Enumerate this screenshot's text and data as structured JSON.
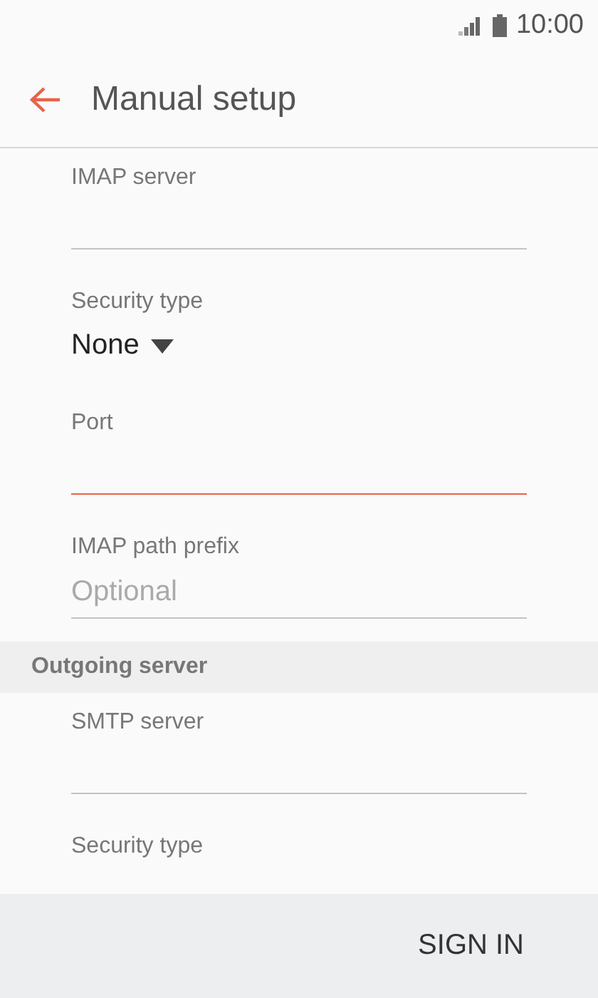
{
  "status_bar": {
    "time": "10:00"
  },
  "app_bar": {
    "title": "Manual setup"
  },
  "content": [
    {
      "kind": "text",
      "label": "IMAP server",
      "focused": false
    },
    {
      "kind": "dropdown",
      "label": "Security type",
      "value": "None"
    },
    {
      "kind": "text",
      "label": "Port",
      "focused": true
    },
    {
      "kind": "text",
      "label": "IMAP path prefix",
      "placeholder": "Optional",
      "focused": false
    },
    {
      "kind": "header",
      "label": "Outgoing server"
    },
    {
      "kind": "text",
      "label": "SMTP server",
      "focused": false
    },
    {
      "kind": "dropdown",
      "label": "Security type"
    }
  ],
  "footer": {
    "button": "SIGN IN"
  }
}
